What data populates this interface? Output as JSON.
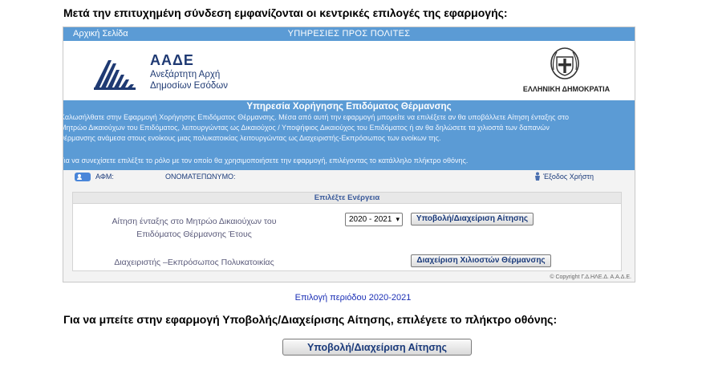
{
  "intro_text": "Μετά την επιτυχημένη σύνδεση εμφανίζονται οι κεντρικές επιλογές της εφαρμογής:",
  "topbar": {
    "home_link": "Αρχική Σελίδα",
    "title": "ΥΠΗΡΕΣΙΕΣ ΠΡΟΣ ΠΟΛΙΤΕΣ"
  },
  "logo": {
    "name": "ΑΑΔΕ",
    "subtitle_line1": "Ανεξάρτητη Αρχή",
    "subtitle_line2": "Δημοσίων Εσόδων",
    "republic": "ΕΛΛΗΝΙΚΗ ΔΗΜΟΚΡΑΤΙΑ"
  },
  "banner": {
    "title": "Υπηρεσία Χορήγησης Επιδόματος Θέρμανσης",
    "line1": "Καλωσήλθατε στην Εφαρμογή Χορήγησης Επιδόματος Θέρμανσης. Μέσα από αυτή την εφαρμογή μπορείτε να επιλέξετε αν θα υποβάλλετε Αίτηση ένταξης στο",
    "line2": "Μητρώο Δικαιούχων του Επιδόματος, λειτουργώντας ως Δικαιούχος / Υποψήφιος Δικαιούχος του Επιδόματος ή αν θα δηλώσετε τα χιλιοστά των δαπανών",
    "line3": "θέρμανσης ανάμεσα στους ενοίκους μιας πολυκατοικίας λειτουργώντας ως Διαχειριστής-Εκπρόσωπος των ενοίκων της.",
    "line4": "Για να συνεχίσετε επιλέξτε το ρόλο με τον οποίο θα χρησιμοποιήσετε την εφαρμογή, επιλέγοντας το κατάλληλο πλήκτρο οθόνης."
  },
  "userbar": {
    "afm_label": "ΑΦΜ:",
    "name_label": "ΟΝΟΜΑΤΕΠΩΝΥΜΟ:",
    "logout": "Έξοδος Χρήστη"
  },
  "panel": {
    "header": "Επιλέξτε Ενέργεια",
    "row1_line1": "Αίτηση ένταξης στο Μητρώο Δικαιούχων του",
    "row1_line2": "Επιδόματος Θέρμανσης Έτους",
    "year_selected": "2020 - 2021",
    "submit_button": "Υποβολή/Διαχείριση Αίτησης",
    "row2_label": "Διαχειριστής –Εκπρόσωπος Πολυκατοικίας",
    "manage_button": "Διαχείριση Χιλιοστών Θέρμανσης",
    "copyright": "© Copyright Γ.Δ.ΗΛΕ.Δ. Α.Α.Δ.Ε."
  },
  "period_text": "Επιλογή περιόδου 2020-2021",
  "instruction_text": "Για να μπείτε στην εφαρμογή Υποβολής/Διαχείρισης Αίτησης, επιλέγετε το πλήκτρο οθόνης:",
  "big_button": "Υποβολή/Διαχείριση Αίτησης",
  "colors": {
    "topbar_blue": "#5b9bd5",
    "brand_navy": "#1f3a73",
    "link_blue": "#1b2fb5"
  }
}
